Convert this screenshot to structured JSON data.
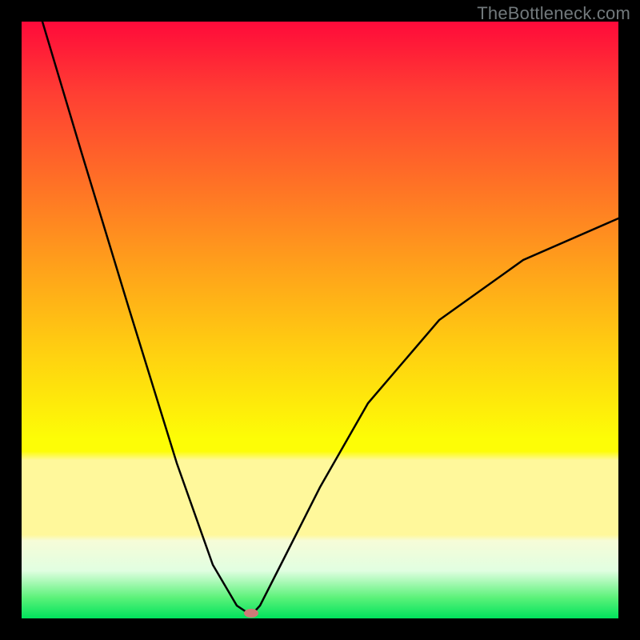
{
  "watermark": "TheBottleneck.com",
  "chart_data": {
    "type": "line",
    "title": "",
    "xlabel": "",
    "ylabel": "",
    "xlim": [
      0,
      100
    ],
    "ylim": [
      0,
      100
    ],
    "series": [
      {
        "name": "bottleneck-curve",
        "x": [
          3.5,
          10,
          18,
          26,
          32,
          36,
          38.5,
          40,
          44,
          50,
          58,
          70,
          84,
          100
        ],
        "values": [
          100,
          78,
          52,
          26,
          9,
          2.2,
          0.5,
          2.2,
          10,
          22,
          36,
          50,
          60,
          67
        ]
      }
    ],
    "marker": {
      "x": 38.5,
      "y": 0.5,
      "color": "#cf7a77"
    },
    "gradient_stops": [
      {
        "pct": 0,
        "color": "#ff0a3a"
      },
      {
        "pct": 70,
        "color": "#fdfd06"
      },
      {
        "pct": 100,
        "color": "#00e25c"
      }
    ]
  }
}
